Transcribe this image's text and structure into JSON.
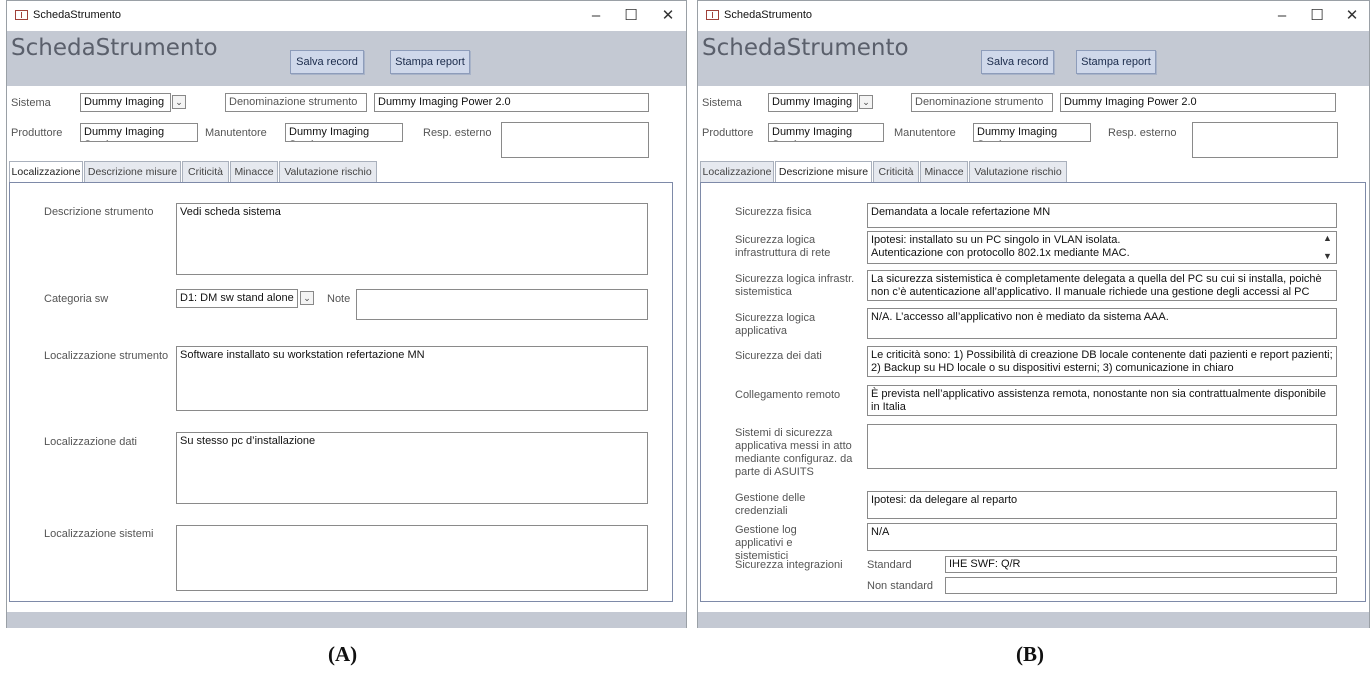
{
  "window_title": "SchedaStrumento",
  "form_title": "SchedaStrumento",
  "buttons": {
    "save": "Salva record",
    "print": "Stampa report"
  },
  "window_controls": {
    "minimize": "–",
    "maximize": "☐",
    "close": "✕"
  },
  "header_fields": {
    "sistema_label": "Sistema",
    "sistema_value": "Dummy Imaging",
    "denominazione_label": "Denominazione strumento",
    "denominazione_value": "Dummy Imaging  Power 2.0",
    "produttore_label": "Produttore",
    "produttore_value": "Dummy Imaging S.p.A.",
    "manutentore_label": "Manutentore",
    "manutentore_value": "Dummy Imaging S.p.A.",
    "resp_label": "Resp. esterno",
    "resp_value": ""
  },
  "tabs": [
    "Localizzazione",
    "Descrizione misure",
    "Criticità",
    "Minacce",
    "Valutazione rischio"
  ],
  "panel_a": {
    "descrizione_label": "Descrizione strumento",
    "descrizione_value": "Vedi scheda sistema",
    "categoria_label": "Categoria sw",
    "categoria_value": "D1: DM sw stand alone",
    "note_label": "Note",
    "note_value": "",
    "loc_strumento_label": "Localizzazione strumento",
    "loc_strumento_value": "Software installato su workstation refertazione MN",
    "loc_dati_label": "Localizzazione dati",
    "loc_dati_value": "Su stesso pc d’installazione",
    "loc_sistemi_label": "Localizzazione sistemi",
    "loc_sistemi_value": ""
  },
  "panel_b": {
    "fisica_label": "Sicurezza fisica",
    "fisica_value": "Demandata a locale refertazione MN",
    "logica_rete_label": "Sicurezza logica infrastruttura di rete",
    "logica_rete_value": "Ipotesi: installato su un PC singolo in VLAN isolata.\nAutenticazione con protocollo 802.1x mediante MAC.",
    "logica_sist_label": "Sicurezza logica infrastr. sistemistica",
    "logica_sist_value": "La sicurezza sistemistica è completamente delegata a quella del PC su cui si installa, poichè non c’è autenticazione all’applicativo. Il manuale richiede una gestione degli accessi al PC",
    "logica_app_label": "Sicurezza logica applicativa",
    "logica_app_value": "N/A. L’accesso all’applicativo non è mediato da sistema AAA.",
    "dati_label": "Sicurezza dei dati",
    "dati_value": "Le criticità sono: 1) Possibilità di creazione DB locale contenente dati pazienti e report pazienti; 2) Backup su HD locale o su dispositivi esterni; 3) comunicazione in chiaro",
    "remoto_label": "Collegamento remoto",
    "remoto_value": "È prevista nell’applicativo assistenza remota, nonostante non sia contrattualmente disponibile in Italia",
    "sistemi_app_label": "Sistemi di sicurezza applicativa messi in atto mediante configuraz. da parte di ASUITS",
    "sistemi_app_value": "",
    "credenziali_label": "Gestione delle credenziali",
    "credenziali_value": "Ipotesi: da delegare al reparto",
    "log_label": "Gestione log applicativi e sistemistici",
    "log_value": "N/A",
    "integrazioni_label": "Sicurezza integrazioni",
    "standard_label": "Standard",
    "standard_value": "IHE SWF: Q/R",
    "non_standard_label": "Non standard",
    "non_standard_value": ""
  },
  "captions": {
    "a": "(A)",
    "b": "(B)"
  }
}
